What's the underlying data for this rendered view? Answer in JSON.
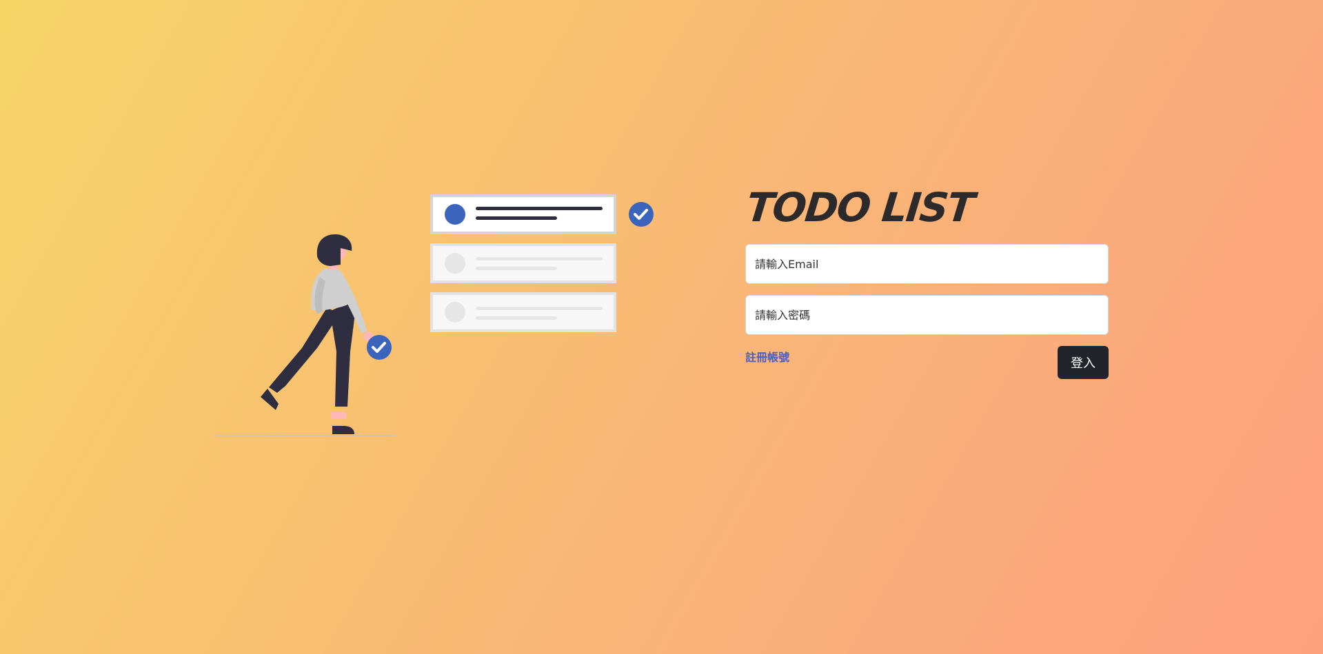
{
  "app": {
    "title": "TODO LIST"
  },
  "login": {
    "email_placeholder": "請輸入Email",
    "email_value": "",
    "password_placeholder": "請輸入密碼",
    "password_value": "",
    "register_label": "註冊帳號",
    "submit_label": "登入"
  },
  "colors": {
    "accent_blue": "#3b64bd",
    "dark": "#212529",
    "link": "#4a5cc5",
    "figure_dark": "#2f2e41",
    "skin": "#ffb8b8"
  },
  "icons": {
    "check_icon": "check-circle-icon",
    "illustration": "woman-walking-checklist-illustration"
  }
}
